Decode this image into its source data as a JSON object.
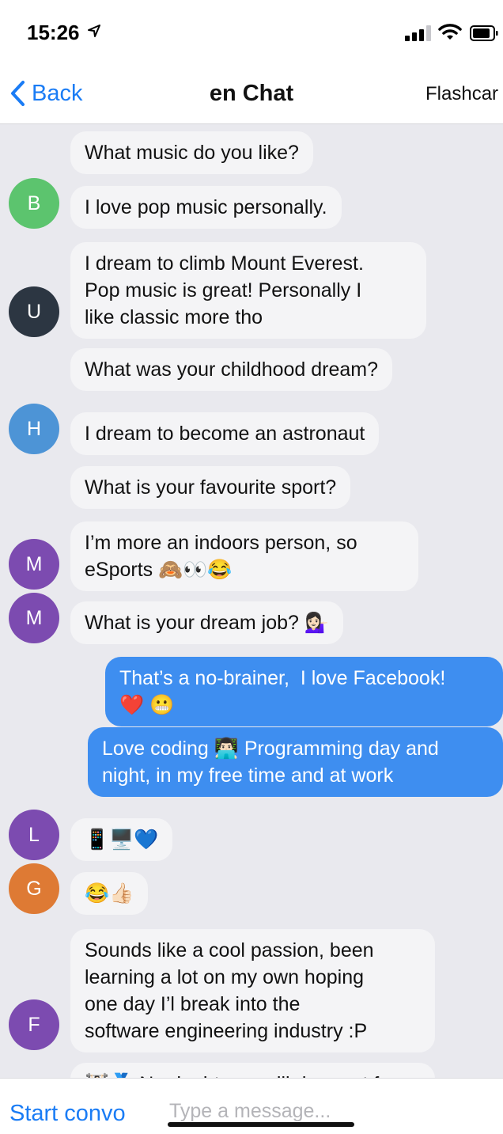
{
  "status": {
    "time": "15:26"
  },
  "nav": {
    "back": "Back",
    "title": "en Chat",
    "flashcards": "Flashcar"
  },
  "messages": [
    {
      "text": "What music do you like?"
    },
    {
      "avatar": "B",
      "text": "I love pop music personally."
    },
    {
      "avatar": "U",
      "text": "I dream to climb Mount Everest.\nPop music is great! Personally I\nlike classic more tho"
    },
    {
      "text": "What was your childhood dream?"
    },
    {
      "avatar": "H",
      "text": "I dream to become an astronaut"
    },
    {
      "text": "What is your favourite sport?"
    },
    {
      "avatar": "M",
      "text": "I’m more an indoors person, so\neSports 🙈👀😂"
    },
    {
      "avatar": "M",
      "text": "What is your dream job? 💁🏻‍♀️"
    },
    {
      "text": "That’s a no-brainer,  I love Facebook!\n❤️ 😬"
    },
    {
      "text": "Love coding 👨🏻‍💻 Programming day and\nnight, in my free time and at work"
    },
    {
      "avatar": "L",
      "text": "📱🖥️💙"
    },
    {
      "avatar": "G",
      "text": "😂👍🏻"
    },
    {
      "avatar": "F",
      "text": "Sounds like a cool passion, been\nlearning a lot on my own hoping\none day I’l break into the\nsoftware engineering industry :P"
    },
    {
      "text": "🏋🏻🏅 No doubt you will do great f"
    }
  ],
  "colors": {
    "avatar_b": "#5cc46e",
    "avatar_u": "#2c3642",
    "avatar_h": "#4d94d6",
    "avatar_m": "#7c4bb0",
    "avatar_l": "#7c4bb0",
    "avatar_g": "#de7a34",
    "avatar_f": "#7c4bb0",
    "accent": "#1a7cf5",
    "outgoing_bubble": "#3e8ef0"
  },
  "compose": {
    "start_label": "Start convo",
    "placeholder": "Type a message..."
  }
}
